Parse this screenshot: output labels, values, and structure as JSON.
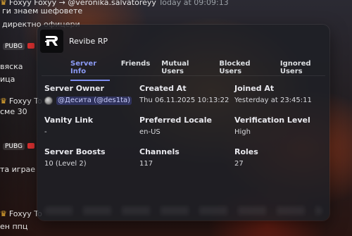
{
  "background_chat": [
    {
      "text": "Foxyy Foxyy → @veronika.salvatoreyy",
      "badge": "Today at 09:09:13"
    },
    {
      "text": "ги знаем шефовете"
    },
    {
      "text": "директно офицери"
    },
    {
      "tag": "PUBG",
      "text": ""
    },
    {
      "text": "вяска"
    },
    {
      "text": "ица"
    },
    {
      "text": "Foxyy To"
    },
    {
      "text": "сме 30"
    },
    {
      "tag": "PUBG",
      "text": ""
    },
    {
      "text": "та играе"
    },
    {
      "text": "Foxyy To"
    },
    {
      "text": "ен ппц"
    }
  ],
  "server": {
    "name": "Revibe RP",
    "icon": "revibe-logo-icon"
  },
  "tabs": [
    {
      "label": "Server Info",
      "active": true
    },
    {
      "label": "Friends",
      "active": false
    },
    {
      "label": "Mutual Users",
      "active": false
    },
    {
      "label": "Blocked Users",
      "active": false
    },
    {
      "label": "Ignored Users",
      "active": false
    }
  ],
  "info": {
    "owner_label": "Server Owner",
    "owner_value": "@Десита (@des1ta)",
    "created_label": "Created At",
    "created_value": "Thu 06.11.2025 10:13:22",
    "joined_label": "Joined At",
    "joined_value": "Yesterday at 23:45:11",
    "vanity_label": "Vanity Link",
    "vanity_value": "-",
    "locale_label": "Preferred Locale",
    "locale_value": "en-US",
    "verification_label": "Verification Level",
    "verification_value": "High",
    "boosts_label": "Server Boosts",
    "boosts_value": "10 (Level 2)",
    "channels_label": "Channels",
    "channels_value": "117",
    "roles_label": "Roles",
    "roles_value": "27"
  },
  "colors": {
    "accent": "#8c9bf5",
    "mention_bg": "#5865f2"
  }
}
